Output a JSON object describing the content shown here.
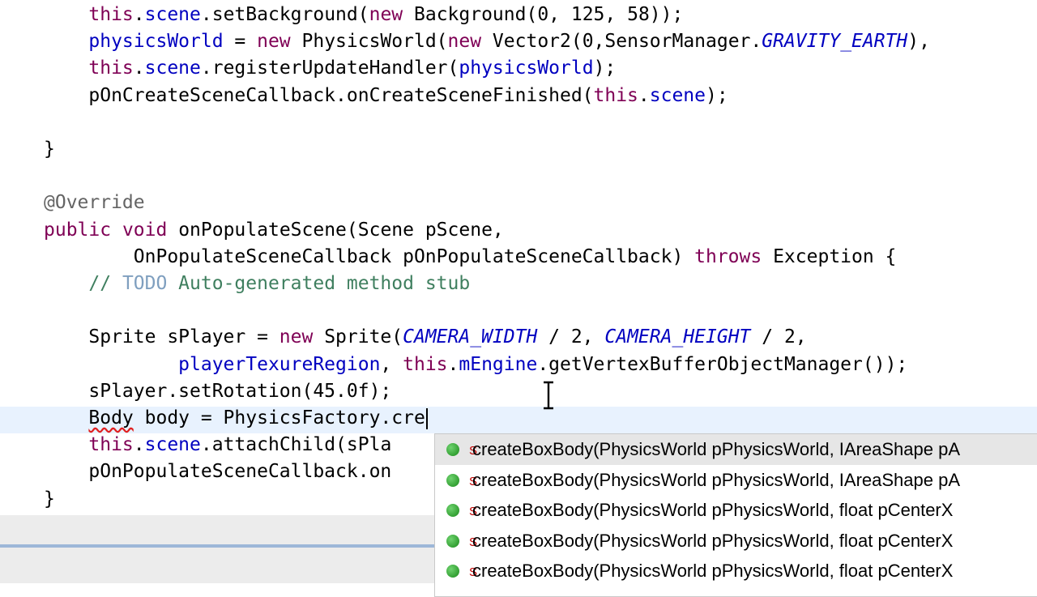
{
  "editor": {
    "lines": [
      [
        {
          "t": "    "
        },
        {
          "t": "this",
          "c": "kw"
        },
        {
          "t": "."
        },
        {
          "t": "scene",
          "c": "field"
        },
        {
          "t": ".setBackground("
        },
        {
          "t": "new",
          "c": "kw"
        },
        {
          "t": " Background(0, 125, 58));"
        }
      ],
      [
        {
          "t": "    "
        },
        {
          "t": "physicsWorld",
          "c": "field"
        },
        {
          "t": " = "
        },
        {
          "t": "new",
          "c": "kw"
        },
        {
          "t": " PhysicsWorld("
        },
        {
          "t": "new",
          "c": "kw"
        },
        {
          "t": " Vector2(0,SensorManager."
        },
        {
          "t": "GRAVITY_EARTH",
          "c": "static"
        },
        {
          "t": "),"
        }
      ],
      [
        {
          "t": "    "
        },
        {
          "t": "this",
          "c": "kw"
        },
        {
          "t": "."
        },
        {
          "t": "scene",
          "c": "field"
        },
        {
          "t": ".registerUpdateHandler("
        },
        {
          "t": "physicsWorld",
          "c": "field"
        },
        {
          "t": ");"
        }
      ],
      [
        {
          "t": "    pOnCreateSceneCallback.onCreateSceneFinished("
        },
        {
          "t": "this",
          "c": "kw"
        },
        {
          "t": "."
        },
        {
          "t": "scene",
          "c": "field"
        },
        {
          "t": ");"
        }
      ],
      [],
      [
        {
          "t": "}"
        }
      ],
      [],
      [
        {
          "t": "@Override",
          "c": "anno"
        }
      ],
      [
        {
          "t": "public",
          "c": "kw"
        },
        {
          "t": " "
        },
        {
          "t": "void",
          "c": "kw"
        },
        {
          "t": " onPopulateScene(Scene pScene,"
        }
      ],
      [
        {
          "t": "        OnPopulateSceneCallback pOnPopulateSceneCallback) "
        },
        {
          "t": "throws",
          "c": "kw"
        },
        {
          "t": " Exception {"
        }
      ],
      [
        {
          "t": "    "
        },
        {
          "t": "// ",
          "c": "comment"
        },
        {
          "t": "TODO",
          "c": "todo"
        },
        {
          "t": " Auto-generated method stub",
          "c": "comment"
        }
      ],
      [],
      [
        {
          "t": "    Sprite sPlayer = "
        },
        {
          "t": "new",
          "c": "kw"
        },
        {
          "t": " Sprite("
        },
        {
          "t": "CAMERA_WIDTH",
          "c": "static"
        },
        {
          "t": " / 2, "
        },
        {
          "t": "CAMERA_HEIGHT",
          "c": "static"
        },
        {
          "t": " / 2,"
        }
      ],
      [
        {
          "t": "            "
        },
        {
          "t": "playerTexureRegion",
          "c": "field"
        },
        {
          "t": ", "
        },
        {
          "t": "this",
          "c": "kw"
        },
        {
          "t": "."
        },
        {
          "t": "mEngine",
          "c": "field"
        },
        {
          "t": ".getVertexBufferObjectManager());"
        }
      ],
      [
        {
          "t": "    sPlayer.setRotation(45.0f);"
        }
      ],
      [
        {
          "t": "    "
        },
        {
          "t": "Body",
          "c": "err"
        },
        {
          "t": " body = PhysicsFactory.cre"
        },
        {
          "caret": true
        }
      ],
      [
        {
          "t": "    "
        },
        {
          "t": "this",
          "c": "kw"
        },
        {
          "t": "."
        },
        {
          "t": "scene",
          "c": "field"
        },
        {
          "t": ".attachChild(sPla"
        }
      ],
      [
        {
          "t": "    pOnPopulateSceneCallback.on"
        }
      ],
      [
        {
          "t": "}"
        }
      ]
    ]
  },
  "completion": {
    "items": [
      {
        "label": "createBoxBody(PhysicsWorld pPhysicsWorld, IAreaShape pA",
        "badge": "S"
      },
      {
        "label": "createBoxBody(PhysicsWorld pPhysicsWorld, IAreaShape pA",
        "badge": "S"
      },
      {
        "label": "createBoxBody(PhysicsWorld pPhysicsWorld, float pCenterX",
        "badge": "S"
      },
      {
        "label": "createBoxBody(PhysicsWorld pPhysicsWorld, float pCenterX",
        "badge": "S"
      },
      {
        "label": "createBoxBody(PhysicsWorld pPhysicsWorld, float pCenterX",
        "badge": "S"
      }
    ],
    "selected_index": 0
  },
  "icons": {
    "method": "public-static-method-icon",
    "cursor": "text-cursor-icon"
  },
  "colors": {
    "keyword": "#7f0055",
    "field": "#0000c0",
    "comment": "#3f7f5f",
    "annotation": "#646464"
  }
}
